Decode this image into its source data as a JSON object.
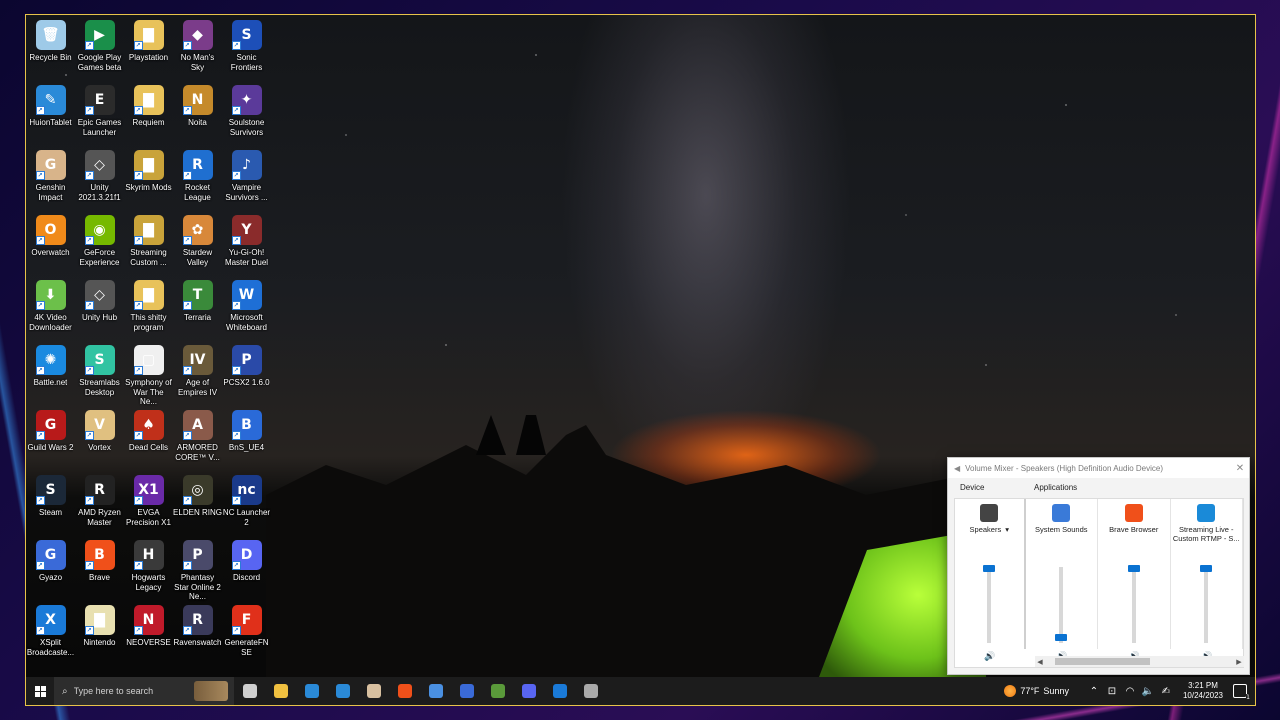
{
  "desktop": {
    "icons": [
      {
        "label": "Recycle Bin",
        "color": "#9ecae8",
        "glyph": "🗑"
      },
      {
        "label": "Google Play Games beta",
        "color": "#1a8f4a",
        "glyph": "▶"
      },
      {
        "label": "Playstation",
        "color": "#e8c25a",
        "glyph": "▇"
      },
      {
        "label": "No Man's Sky",
        "color": "#7b3c8a",
        "glyph": "◆"
      },
      {
        "label": "Sonic Frontiers",
        "color": "#1d4fb8",
        "glyph": "S"
      },
      {
        "label": "HuionTablet",
        "color": "#2a8ad8",
        "glyph": "✎"
      },
      {
        "label": "Epic Games Launcher",
        "color": "#2b2b2b",
        "glyph": "E"
      },
      {
        "label": "Requiem",
        "color": "#e8c25a",
        "glyph": "▇"
      },
      {
        "label": "Noita",
        "color": "#c58a2b",
        "glyph": "N"
      },
      {
        "label": "Soulstone Survivors",
        "color": "#5b3a9a",
        "glyph": "✦"
      },
      {
        "label": "Genshin Impact",
        "color": "#d8b48a",
        "glyph": "G"
      },
      {
        "label": "Unity 2021.3.21f1",
        "color": "#555",
        "glyph": "◇"
      },
      {
        "label": "Skyrim Mods",
        "color": "#c9a33a",
        "glyph": "▇"
      },
      {
        "label": "Rocket League",
        "color": "#1f6fd0",
        "glyph": "R"
      },
      {
        "label": "Vampire Survivors ...",
        "color": "#2a5ab0",
        "glyph": "♪"
      },
      {
        "label": "Overwatch",
        "color": "#f08a1a",
        "glyph": "O"
      },
      {
        "label": "GeForce Experience",
        "color": "#76b900",
        "glyph": "◉"
      },
      {
        "label": "Streaming Custom ...",
        "color": "#c9a33a",
        "glyph": "▇"
      },
      {
        "label": "Stardew Valley",
        "color": "#d8883a",
        "glyph": "✿"
      },
      {
        "label": "Yu-Gi-Oh! Master Duel",
        "color": "#8a2b2b",
        "glyph": "Y"
      },
      {
        "label": "4K Video Downloader",
        "color": "#6cc04a",
        "glyph": "⬇"
      },
      {
        "label": "Unity Hub",
        "color": "#555",
        "glyph": "◇"
      },
      {
        "label": "This shitty program",
        "color": "#e8c25a",
        "glyph": "▇"
      },
      {
        "label": "Terraria",
        "color": "#3a8a3a",
        "glyph": "T"
      },
      {
        "label": "Microsoft Whiteboard",
        "color": "#1e6fd6",
        "glyph": "W"
      },
      {
        "label": "Battle.net",
        "color": "#1a8ae0",
        "glyph": "✺"
      },
      {
        "label": "Streamlabs Desktop",
        "color": "#31c3a2",
        "glyph": "S"
      },
      {
        "label": "Symphony of War The Ne...",
        "color": "#f0f0f0",
        "glyph": "▢"
      },
      {
        "label": "Age of Empires IV",
        "color": "#6a5a3a",
        "glyph": "IV"
      },
      {
        "label": "PCSX2 1.6.0",
        "color": "#2a4aa8",
        "glyph": "P"
      },
      {
        "label": "Guild Wars 2",
        "color": "#b81a1a",
        "glyph": "G"
      },
      {
        "label": "Vortex",
        "color": "#e0c080",
        "glyph": "V"
      },
      {
        "label": "Dead Cells",
        "color": "#c0301a",
        "glyph": "♠"
      },
      {
        "label": "ARMORED CORE™ V...",
        "color": "#8a5a4a",
        "glyph": "A"
      },
      {
        "label": "BnS_UE4",
        "color": "#2a6ad8",
        "glyph": "B"
      },
      {
        "label": "Steam",
        "color": "#1b2838",
        "glyph": "S"
      },
      {
        "label": "AMD Ryzen Master",
        "color": "#222",
        "glyph": "R"
      },
      {
        "label": "EVGA Precision X1",
        "color": "#6a2aa8",
        "glyph": "X1"
      },
      {
        "label": "ELDEN RING",
        "color": "#3a3a2a",
        "glyph": "◎"
      },
      {
        "label": "NC Launcher 2",
        "color": "#1a3a8a",
        "glyph": "nc"
      },
      {
        "label": "Gyazo",
        "color": "#3a6ad8",
        "glyph": "G"
      },
      {
        "label": "Brave",
        "color": "#f0501a",
        "glyph": "B"
      },
      {
        "label": "Hogwarts Legacy",
        "color": "#3a3a3a",
        "glyph": "H"
      },
      {
        "label": "Phantasy Star Online 2 Ne...",
        "color": "#4a4a6a",
        "glyph": "P"
      },
      {
        "label": "Discord",
        "color": "#5865f2",
        "glyph": "D"
      },
      {
        "label": "XSplit Broadcaste...",
        "color": "#1a7ad8",
        "glyph": "X"
      },
      {
        "label": "Nintendo",
        "color": "#e8e0b0",
        "glyph": "▇"
      },
      {
        "label": "NEOVERSE",
        "color": "#c01a2a",
        "glyph": "N"
      },
      {
        "label": "Ravenswatch",
        "color": "#3a3a5a",
        "glyph": "R"
      },
      {
        "label": "GenerateFN SE",
        "color": "#e0301a",
        "glyph": "F"
      }
    ]
  },
  "taskbar": {
    "search_placeholder": "Type here to search",
    "apps": [
      {
        "name": "task-view-icon",
        "color": "#cfcfcf"
      },
      {
        "name": "file-explorer-icon",
        "color": "#f0c040"
      },
      {
        "name": "store-icon",
        "color": "#2a8ad8"
      },
      {
        "name": "mail-icon",
        "color": "#2a8ad8"
      },
      {
        "name": "photos-icon",
        "color": "#d8c0a0"
      },
      {
        "name": "brave-icon",
        "color": "#f0501a"
      },
      {
        "name": "chrome-icon",
        "color": "#4a90e2"
      },
      {
        "name": "steam-like-icon",
        "color": "#3a6ad8"
      },
      {
        "name": "minecraft-icon",
        "color": "#5a9a3a"
      },
      {
        "name": "discord-icon",
        "color": "#5865f2"
      },
      {
        "name": "xsplit-icon",
        "color": "#1a7ad8"
      },
      {
        "name": "shield-icon",
        "color": "#aaaaaa"
      }
    ],
    "weather_temp": "77°F",
    "weather_cond": "Sunny",
    "time": "3:21 PM",
    "date": "10/24/2023",
    "notification_count": "1"
  },
  "mixer": {
    "title": "Volume Mixer - Speakers (High Definition Audio Device)",
    "device_label": "Device",
    "applications_label": "Applications",
    "channels": [
      {
        "name": "Speakers",
        "level": 1.0,
        "icon_color": "#444"
      },
      {
        "name": "System Sounds",
        "level": 0.0,
        "icon_color": "#3a7ad8"
      },
      {
        "name": "Brave Browser",
        "level": 1.0,
        "icon_color": "#f0501a"
      },
      {
        "name": "Streaming Live - Custom RTMP - S...",
        "level": 1.0,
        "icon_color": "#1a8ad8"
      }
    ]
  }
}
